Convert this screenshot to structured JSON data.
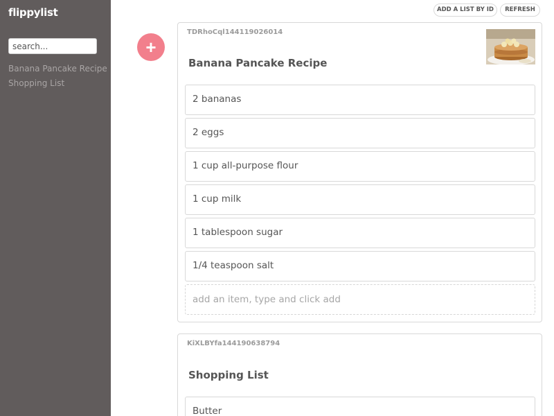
{
  "sidebar": {
    "brand": "flippylist",
    "search_placeholder": "search...",
    "lists": [
      "Banana Pancake Recipe",
      "Shopping List"
    ]
  },
  "toolbar": {
    "add_list_by_id_label": "ADD A LIST BY ID",
    "refresh_label": "REFRESH",
    "add_button_label": "+"
  },
  "lists": [
    {
      "id": "TDRhoCql144119026014",
      "title": "Banana Pancake Recipe",
      "has_image": true,
      "items": [
        "2 bananas",
        "2 eggs",
        "1 cup all-purpose flour",
        "1 cup milk",
        "1 tablespoon sugar",
        "1/4 teaspoon salt"
      ],
      "add_placeholder": "add an item, type and click add"
    },
    {
      "id": "KiXLBYfa144190638794",
      "title": "Shopping List",
      "has_image": false,
      "items": [
        "Butter"
      ]
    }
  ],
  "colors": {
    "sidebar_bg": "#615c5c",
    "accent": "#f27f8c"
  }
}
